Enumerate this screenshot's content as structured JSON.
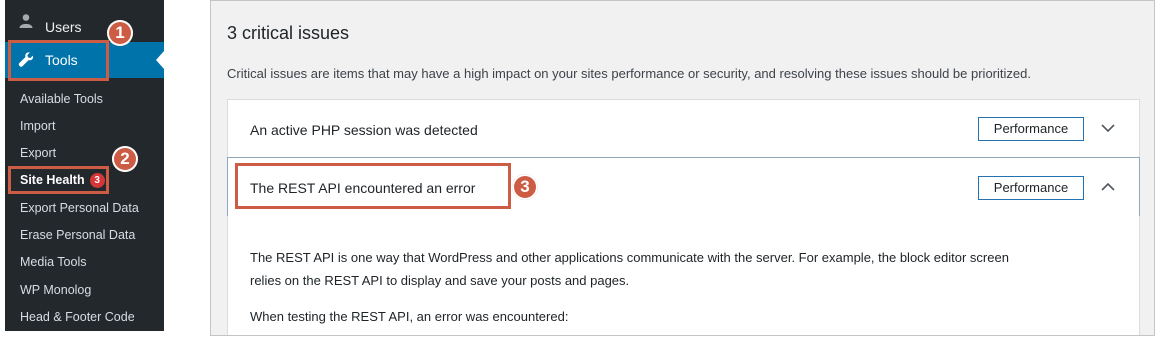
{
  "sidebar": {
    "users_label": "Users",
    "tools_label": "Tools",
    "submenu": [
      {
        "label": "Available Tools"
      },
      {
        "label": "Import"
      },
      {
        "label": "Export"
      },
      {
        "label": "Site Health",
        "badge": "3",
        "current": true
      },
      {
        "label": "Export Personal Data"
      },
      {
        "label": "Erase Personal Data"
      },
      {
        "label": "Media Tools"
      },
      {
        "label": "WP Monolog"
      },
      {
        "label": "Head & Footer Code"
      }
    ]
  },
  "annotations": {
    "step1": "1",
    "step2": "2",
    "step3": "3",
    "highlight_color": "#cd5c45"
  },
  "main": {
    "title": "3 critical issues",
    "description": "Critical issues are items that may have a high impact on your sites performance or security, and resolving these issues should be prioritized.",
    "issues": [
      {
        "title": "An active PHP session was detected",
        "badge": "Performance",
        "expanded": false
      },
      {
        "title": "The REST API encountered an error",
        "badge": "Performance",
        "expanded": true,
        "body": [
          "The REST API is one way that WordPress and other applications communicate with the server. For example, the block editor screen",
          "relies on the REST API to display and save your posts and pages.",
          "When testing the REST API, an error was encountered:"
        ]
      }
    ]
  },
  "colors": {
    "sidebar_bg": "#23282d",
    "active_menu": "#0073aa",
    "badge_border": "#2271b1",
    "count_badge": "#d63638"
  }
}
